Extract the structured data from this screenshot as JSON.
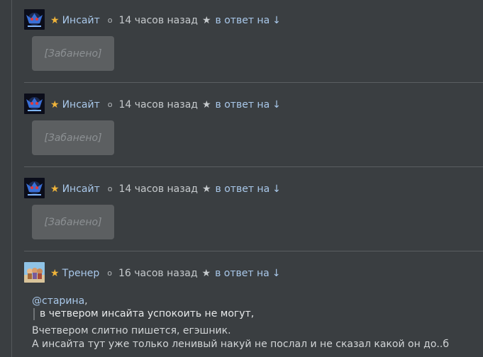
{
  "comments": [
    {
      "author": "Инсайт",
      "time": "14 часов назад",
      "reply_label": "в ответ на",
      "arrow": "↓",
      "content": "[Забанено]"
    },
    {
      "author": "Инсайт",
      "time": "14 часов назад",
      "reply_label": "в ответ на",
      "arrow": "↓",
      "content": "[Забанено]"
    },
    {
      "author": "Инсайт",
      "time": "14 часов назад",
      "reply_label": "в ответ на",
      "arrow": "↓",
      "content": "[Забанено]"
    },
    {
      "author": "Тренер",
      "time": "16 часов назад",
      "reply_label": "в ответ на",
      "arrow": "↓",
      "mention": "@старина",
      "mention_suffix": ",",
      "quote": "в четвером инсайта успокоить не могут,",
      "lines": [
        "Вчетвером слитно пишется, егэшник.",
        "А инсайта тут уже только ленивый накуй не послал и не сказал какой он до..б"
      ]
    }
  ],
  "icons": {
    "star": "★",
    "dot": "о",
    "separator_star": "★"
  },
  "colors": {
    "background": "#3a3e41",
    "link": "#a9c8ea",
    "star": "#f0b43a",
    "banned_box": "#5c5f61"
  }
}
